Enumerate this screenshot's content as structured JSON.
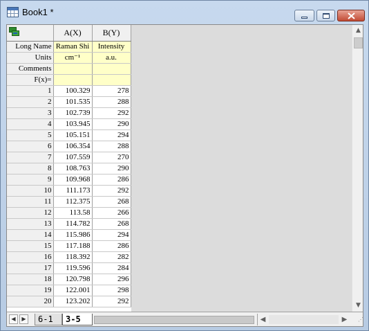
{
  "window": {
    "title": "Book1 *"
  },
  "columns": {
    "a_header": "A(X)",
    "b_header": "B(Y)"
  },
  "meta_rows": [
    {
      "label": "Long Name",
      "a": "Raman Shi",
      "b": "Intensity"
    },
    {
      "label": "Units",
      "a": "cm⁻¹",
      "b": "a.u."
    },
    {
      "label": "Comments",
      "a": "",
      "b": ""
    },
    {
      "label": "F(x)=",
      "a": "",
      "b": ""
    }
  ],
  "rows": [
    {
      "n": "1",
      "x": "100.329",
      "y": "278"
    },
    {
      "n": "2",
      "x": "101.535",
      "y": "288"
    },
    {
      "n": "3",
      "x": "102.739",
      "y": "292"
    },
    {
      "n": "4",
      "x": "103.945",
      "y": "290"
    },
    {
      "n": "5",
      "x": "105.151",
      "y": "294"
    },
    {
      "n": "6",
      "x": "106.354",
      "y": "288"
    },
    {
      "n": "7",
      "x": "107.559",
      "y": "270"
    },
    {
      "n": "8",
      "x": "108.763",
      "y": "290"
    },
    {
      "n": "9",
      "x": "109.968",
      "y": "286"
    },
    {
      "n": "10",
      "x": "111.173",
      "y": "292"
    },
    {
      "n": "11",
      "x": "112.375",
      "y": "268"
    },
    {
      "n": "12",
      "x": "113.58",
      "y": "266"
    },
    {
      "n": "13",
      "x": "114.782",
      "y": "268"
    },
    {
      "n": "14",
      "x": "115.986",
      "y": "294"
    },
    {
      "n": "15",
      "x": "117.188",
      "y": "286"
    },
    {
      "n": "16",
      "x": "118.392",
      "y": "282"
    },
    {
      "n": "17",
      "x": "119.596",
      "y": "284"
    },
    {
      "n": "18",
      "x": "120.798",
      "y": "296"
    },
    {
      "n": "19",
      "x": "122.001",
      "y": "298"
    },
    {
      "n": "20",
      "x": "123.202",
      "y": "292"
    }
  ],
  "sheet_tabs": [
    {
      "label": "6-1",
      "active": false
    },
    {
      "label": "3-5",
      "active": true
    }
  ],
  "icons": {
    "titlebar": "workbook-grid-icon",
    "corner": "column-select-icon",
    "minimize": "minimize-icon",
    "maximize": "maximize-icon",
    "close": "close-icon"
  },
  "colors": {
    "meta_fill": "#ffffc8",
    "header_fill": "#f0f0f0",
    "empty_area": "#dcdcdc"
  }
}
